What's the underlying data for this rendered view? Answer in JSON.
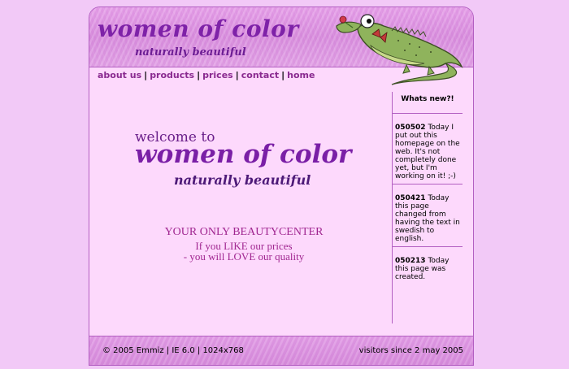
{
  "header": {
    "title": "women of color",
    "subtitle": "naturally beautiful"
  },
  "nav": {
    "items": [
      "about us",
      "products",
      "prices",
      "contact",
      "home"
    ]
  },
  "welcome": {
    "intro": "welcome to",
    "title": "women of color",
    "subtitle": "naturally beautiful"
  },
  "promo": {
    "headline": "YOUR ONLY BEAUTYCENTER",
    "line1": "If you LIKE our prices",
    "line2": "- you will LOVE our quality"
  },
  "sidebar": {
    "heading": "Whats new?!",
    "news": [
      {
        "date": "050502",
        "text": " Today I put out this homepage on the web. It's not completely done yet, but I'm working on it! ;-)"
      },
      {
        "date": "050421",
        "text": " Today this page changed from having the text in swedish to english."
      },
      {
        "date": "050213",
        "text": " Today this page was created."
      }
    ]
  },
  "footer": {
    "left": "© 2005 Emmiz | IE 6.0 | 1024x768",
    "right": "visitors since 2 may 2005"
  },
  "colors": {
    "background": "#f2c9f7",
    "panel": "#fdd9fc",
    "header": "#d98fde",
    "brand_text": "#7e22a8",
    "nav_link": "#8a2a90",
    "promo_text": "#a02690",
    "border": "#b35fc2"
  },
  "icons": {
    "mascot": "crocodile-illustration"
  }
}
